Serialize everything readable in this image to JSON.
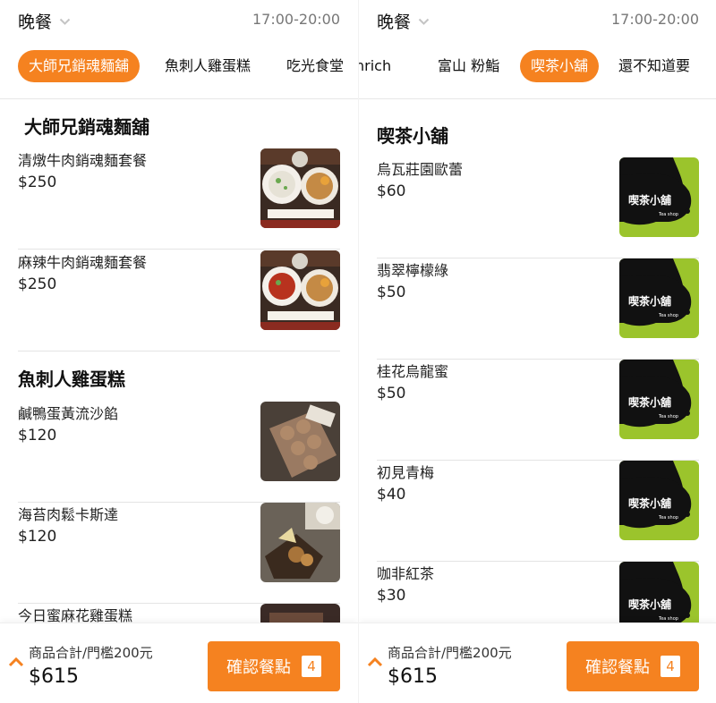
{
  "colors": {
    "accent": "#f58220",
    "tea_green": "#9bc42c",
    "tea_black": "#111111"
  },
  "left": {
    "meal": "晚餐",
    "time_range": "17:00-20:00",
    "tabs": [
      "大師兄銷魂麵舖",
      "魚刺人雞蛋糕",
      "吃光食堂"
    ],
    "active_tab": "大師兄銷魂麵舖",
    "sections": [
      {
        "title": "大師兄銷魂麵舖",
        "items": [
          {
            "name": "清燉牛肉銷魂麵套餐",
            "price": "$250",
            "image": "clear-broth-noodle-set-photo"
          },
          {
            "name": "麻辣牛肉銷魂麵套餐",
            "price": "$250",
            "image": "spicy-beef-noodle-set-photo"
          }
        ]
      },
      {
        "title": "魚刺人雞蛋糕",
        "items": [
          {
            "name": "鹹鴨蛋黃流沙餡",
            "price": "$120",
            "image": "egg-waffle-photo"
          },
          {
            "name": "海苔肉鬆卡斯達",
            "price": "$120",
            "image": "seaweed-floss-custard-photo"
          },
          {
            "name": "今日蜜麻花雞蛋糕",
            "price": "",
            "image": "honey-twist-cake-photo"
          }
        ]
      }
    ],
    "footer": {
      "sum_label": "商品合計/門檻200元",
      "total": "$615",
      "confirm_label": "確認餐點",
      "count": "4"
    }
  },
  "right": {
    "meal": "晚餐",
    "time_range": "17:00-20:00",
    "tabs": [
      "nrich",
      "富山 粉鮨",
      "喫茶小舖",
      "還不知道要"
    ],
    "active_tab": "喫茶小舖",
    "sections": [
      {
        "title": "喫茶小舖",
        "items": [
          {
            "name": "烏瓦莊園歐蕾",
            "price": "$60",
            "image": "tea-shop-logo"
          },
          {
            "name": "翡翠檸檬綠",
            "price": "$50",
            "image": "tea-shop-logo"
          },
          {
            "name": "桂花烏龍蜜",
            "price": "$50",
            "image": "tea-shop-logo"
          },
          {
            "name": "初見青梅",
            "price": "$40",
            "image": "tea-shop-logo"
          },
          {
            "name": "咖非紅茶",
            "price": "$30",
            "image": "tea-shop-logo"
          }
        ]
      }
    ],
    "logo_text": {
      "main": "喫茶小舖",
      "sub": "Tea shop"
    },
    "footer": {
      "sum_label": "商品合計/門檻200元",
      "total": "$615",
      "confirm_label": "確認餐點",
      "count": "4"
    }
  }
}
